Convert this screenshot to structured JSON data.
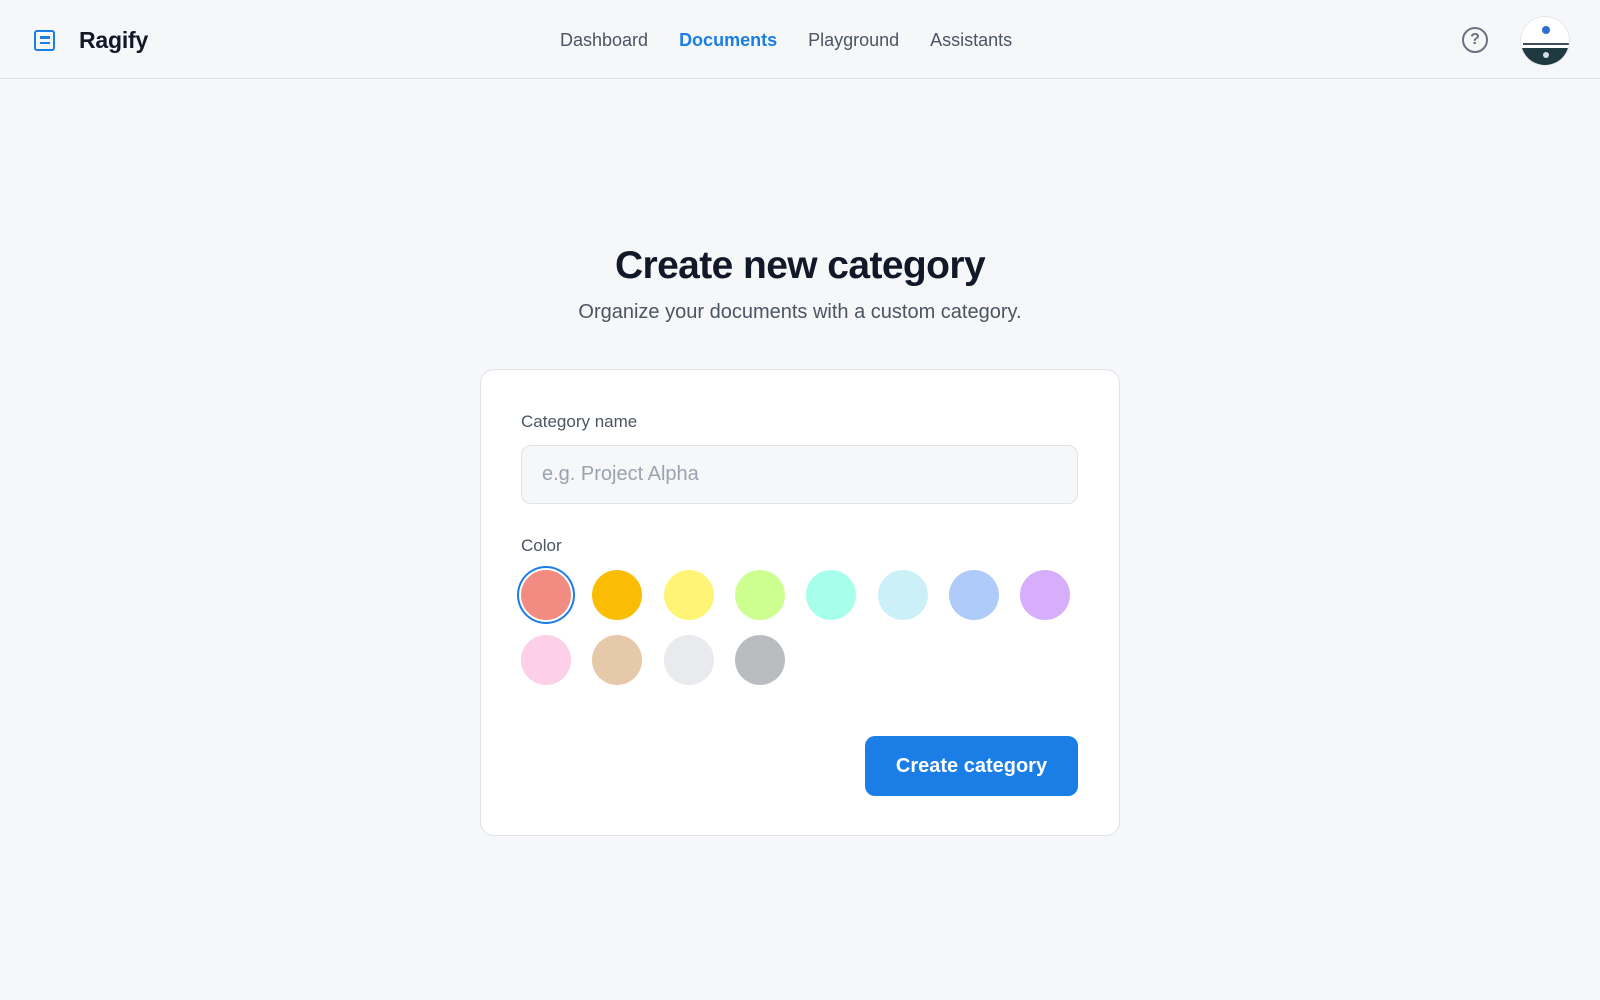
{
  "app": {
    "name": "Ragify",
    "logo_icon": "document-icon"
  },
  "nav": {
    "items": [
      {
        "label": "Dashboard",
        "active": false
      },
      {
        "label": "Documents",
        "active": true
      },
      {
        "label": "Playground",
        "active": false
      },
      {
        "label": "Assistants",
        "active": false
      }
    ]
  },
  "header": {
    "help_icon": "help-circle-icon",
    "help_glyph": "?",
    "avatar_icon": "user-avatar"
  },
  "page": {
    "title": "Create new category",
    "subtitle": "Organize your documents with a custom category."
  },
  "form": {
    "name_label": "Category name",
    "name_value": "",
    "name_placeholder": "e.g. Project Alpha",
    "color_label": "Color",
    "colors": [
      "#f28b82",
      "#fbbc04",
      "#fff475",
      "#ccff90",
      "#a7ffeb",
      "#cbf0f8",
      "#aecbfa",
      "#d7aefb",
      "#fdcfe8",
      "#e6c9a8",
      "#e8eaed",
      "#babdbf"
    ],
    "selected_color_index": 0,
    "submit_label": "Create category"
  },
  "colors": {
    "accent": "#1a7ee6",
    "background": "#f5f7f9",
    "card": "#ffffff"
  }
}
